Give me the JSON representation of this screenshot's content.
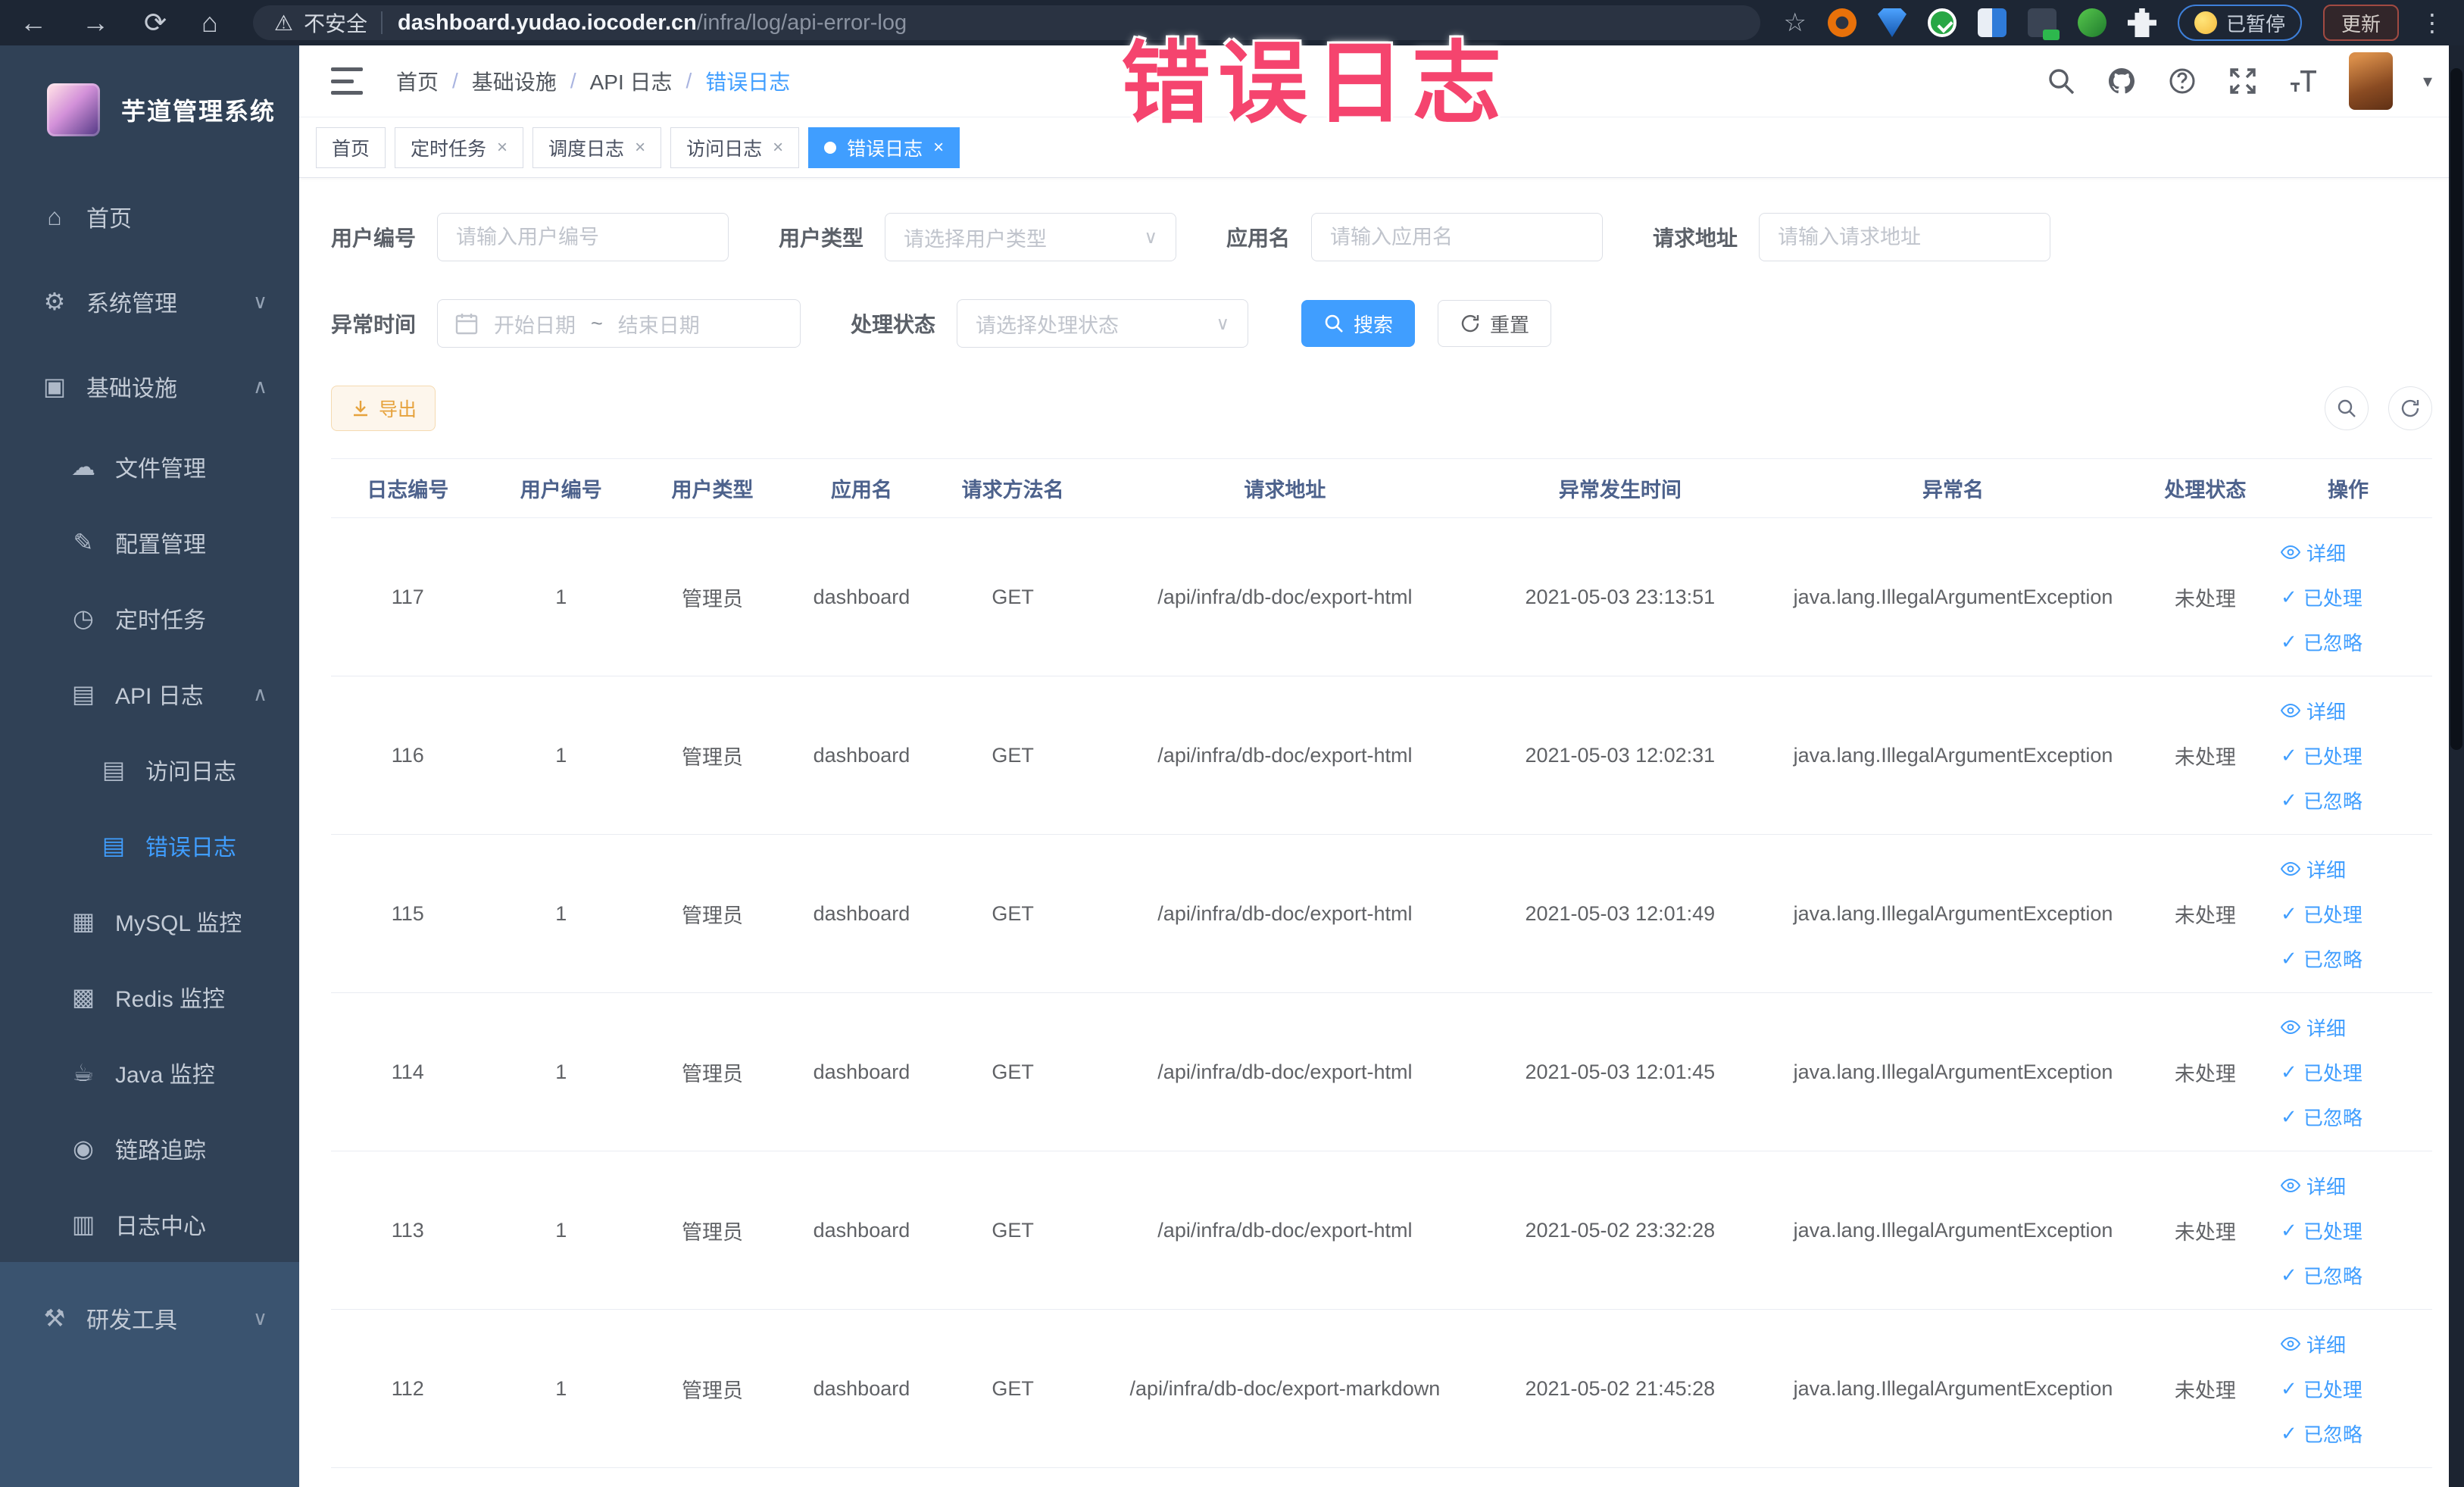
{
  "browser": {
    "security_label": "不安全",
    "url_domain": "dashboard.yudao.iocoder.cn",
    "url_path": "/infra/log/api-error-log",
    "paused_label": "已暂停",
    "update_label": "更新"
  },
  "annotation": {
    "text": "错误日志"
  },
  "icons": {
    "back": "←",
    "forward": "→",
    "reload": "⟳",
    "home": "⌂",
    "warning": "⚠",
    "star": "☆",
    "menu_dots": "⋮",
    "close": "×",
    "check": "✓",
    "chevron_down": "∨",
    "chevron_up": "∧",
    "caret_down": "▾",
    "select_caret": "∨",
    "font_size_glyph": "T"
  },
  "sidebar": {
    "title": "芋道管理系统",
    "items": [
      {
        "label": "首页",
        "icon": "⌂"
      },
      {
        "label": "系统管理",
        "icon": "⚙",
        "chevron": "∨"
      },
      {
        "label": "基础设施",
        "icon": "▣",
        "chevron": "∧"
      },
      {
        "label": "文件管理",
        "icon": "☁"
      },
      {
        "label": "配置管理",
        "icon": "✎"
      },
      {
        "label": "定时任务",
        "icon": "◷"
      },
      {
        "label": "API 日志",
        "icon": "▤",
        "chevron": "∧"
      },
      {
        "label": "访问日志",
        "icon": "▤"
      },
      {
        "label": "错误日志",
        "icon": "▤"
      },
      {
        "label": "MySQL 监控",
        "icon": "▦"
      },
      {
        "label": "Redis 监控",
        "icon": "▩"
      },
      {
        "label": "Java 监控",
        "icon": "☕"
      },
      {
        "label": "链路追踪",
        "icon": "◉"
      },
      {
        "label": "日志中心",
        "icon": "▥"
      },
      {
        "label": "研发工具",
        "icon": "⚒",
        "chevron": "∨"
      }
    ]
  },
  "header": {
    "breadcrumb": [
      "首页",
      "基础设施",
      "API 日志",
      "错误日志"
    ],
    "separator": "/"
  },
  "tabs": [
    {
      "label": "首页"
    },
    {
      "label": "定时任务"
    },
    {
      "label": "调度日志"
    },
    {
      "label": "访问日志"
    },
    {
      "label": "错误日志"
    }
  ],
  "filters": {
    "user_id_label": "用户编号",
    "user_id_placeholder": "请输入用户编号",
    "user_type_label": "用户类型",
    "user_type_placeholder": "请选择用户类型",
    "app_label": "应用名",
    "app_placeholder": "请输入应用名",
    "url_label": "请求地址",
    "url_placeholder": "请输入请求地址",
    "time_label": "异常时间",
    "time_start_placeholder": "开始日期",
    "time_separator": "~",
    "time_end_placeholder": "结束日期",
    "status_label": "处理状态",
    "status_placeholder": "请选择处理状态",
    "search_button": "搜索",
    "reset_button": "重置"
  },
  "toolbar": {
    "export_button": "导出"
  },
  "table": {
    "columns": [
      "日志编号",
      "用户编号",
      "用户类型",
      "应用名",
      "请求方法名",
      "请求地址",
      "异常发生时间",
      "异常名",
      "处理状态",
      "操作"
    ],
    "actions": [
      "详细",
      "已处理",
      "已忽略"
    ],
    "rows": [
      {
        "id": "117",
        "user_id": "1",
        "user_type": "管理员",
        "app": "dashboard",
        "method": "GET",
        "url": "/api/infra/db-doc/export-html",
        "time": "2021-05-03 23:13:51",
        "exception": "java.lang.IllegalArgumentException",
        "status": "未处理"
      },
      {
        "id": "116",
        "user_id": "1",
        "user_type": "管理员",
        "app": "dashboard",
        "method": "GET",
        "url": "/api/infra/db-doc/export-html",
        "time": "2021-05-03 12:02:31",
        "exception": "java.lang.IllegalArgumentException",
        "status": "未处理"
      },
      {
        "id": "115",
        "user_id": "1",
        "user_type": "管理员",
        "app": "dashboard",
        "method": "GET",
        "url": "/api/infra/db-doc/export-html",
        "time": "2021-05-03 12:01:49",
        "exception": "java.lang.IllegalArgumentException",
        "status": "未处理"
      },
      {
        "id": "114",
        "user_id": "1",
        "user_type": "管理员",
        "app": "dashboard",
        "method": "GET",
        "url": "/api/infra/db-doc/export-html",
        "time": "2021-05-03 12:01:45",
        "exception": "java.lang.IllegalArgumentException",
        "status": "未处理"
      },
      {
        "id": "113",
        "user_id": "1",
        "user_type": "管理员",
        "app": "dashboard",
        "method": "GET",
        "url": "/api/infra/db-doc/export-html",
        "time": "2021-05-02 23:32:28",
        "exception": "java.lang.IllegalArgumentException",
        "status": "未处理"
      },
      {
        "id": "112",
        "user_id": "1",
        "user_type": "管理员",
        "app": "dashboard",
        "method": "GET",
        "url": "/api/infra/db-doc/export-markdown",
        "time": "2021-05-02 21:45:28",
        "exception": "java.lang.IllegalArgumentException",
        "status": "未处理"
      }
    ]
  }
}
